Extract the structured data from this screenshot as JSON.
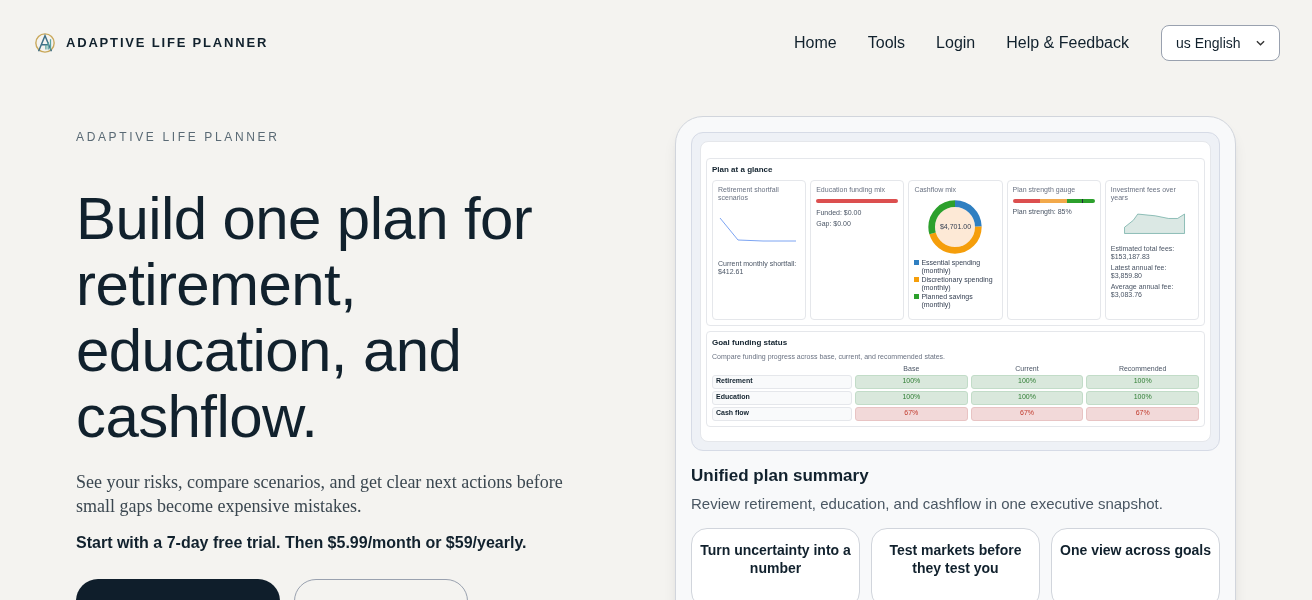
{
  "brand": {
    "name": "ADAPTIVE LIFE PLANNER"
  },
  "nav": [
    {
      "label": "Home"
    },
    {
      "label": "Tools"
    },
    {
      "label": "Login"
    },
    {
      "label": "Help & Feedback"
    }
  ],
  "language_select": {
    "value": "us English"
  },
  "hero": {
    "eyebrow": "ADAPTIVE LIFE PLANNER",
    "heading": "Build one plan for retirement, education, and cashflow.",
    "lead": "See your risks, compare scenarios, and get clear next actions before small gaps become expensive mistakes.",
    "offer": "Start with a 7-day free trial. Then $5.99/month or $59/yearly."
  },
  "preview": {
    "glance_title": "Plan at a glance",
    "cards": [
      {
        "kind": "line",
        "title": "Retirement shortfall scenarios",
        "notes": [
          "Current monthly shortfall: $412.61"
        ]
      },
      {
        "kind": "bar",
        "title": "Education funding mix",
        "notes": [
          "Funded: $0.00",
          "Gap: $0.00"
        ]
      },
      {
        "kind": "donut",
        "title": "Cashflow mix",
        "center": "$4,701.00",
        "legend": [
          {
            "label": "Essential spending (monthly)",
            "color": "#2f7fc1"
          },
          {
            "label": "Discretionary spending (monthly)",
            "color": "#f59e0b"
          },
          {
            "label": "Planned savings (monthly)",
            "color": "#2ca02c"
          }
        ]
      },
      {
        "kind": "gauge",
        "title": "Plan strength gauge",
        "level": 0.85,
        "notes": [
          "Plan strength: 85%"
        ]
      },
      {
        "kind": "area",
        "title": "Investment fees over years",
        "notes": [
          "Estimated total fees: $153,187.83",
          "Latest annual fee: $3,859.80",
          "Average annual fee: $3,083.76"
        ]
      }
    ],
    "goals": {
      "title": "Goal funding status",
      "subtitle": "Compare funding progress across base, current, and recommended states.",
      "columns": [
        "Base",
        "Current",
        "Recommended"
      ],
      "rows": [
        {
          "label": "Retirement",
          "cells": [
            {
              "value": "100%",
              "funded": true
            },
            {
              "value": "100%",
              "funded": true
            },
            {
              "value": "100%",
              "funded": true
            }
          ]
        },
        {
          "label": "Education",
          "cells": [
            {
              "value": "100%",
              "funded": true
            },
            {
              "value": "100%",
              "funded": true
            },
            {
              "value": "100%",
              "funded": true
            }
          ]
        },
        {
          "label": "Cash flow",
          "cells": [
            {
              "value": "67%",
              "funded": false
            },
            {
              "value": "67%",
              "funded": false
            },
            {
              "value": "67%",
              "funded": false
            }
          ]
        }
      ]
    }
  },
  "summary": {
    "title": "Unified plan summary",
    "subtitle": "Review retirement, education, and cashflow in one executive snapshot.",
    "features": [
      "Turn uncertainty into a number",
      "Test markets before they test you",
      "One view across goals"
    ]
  }
}
